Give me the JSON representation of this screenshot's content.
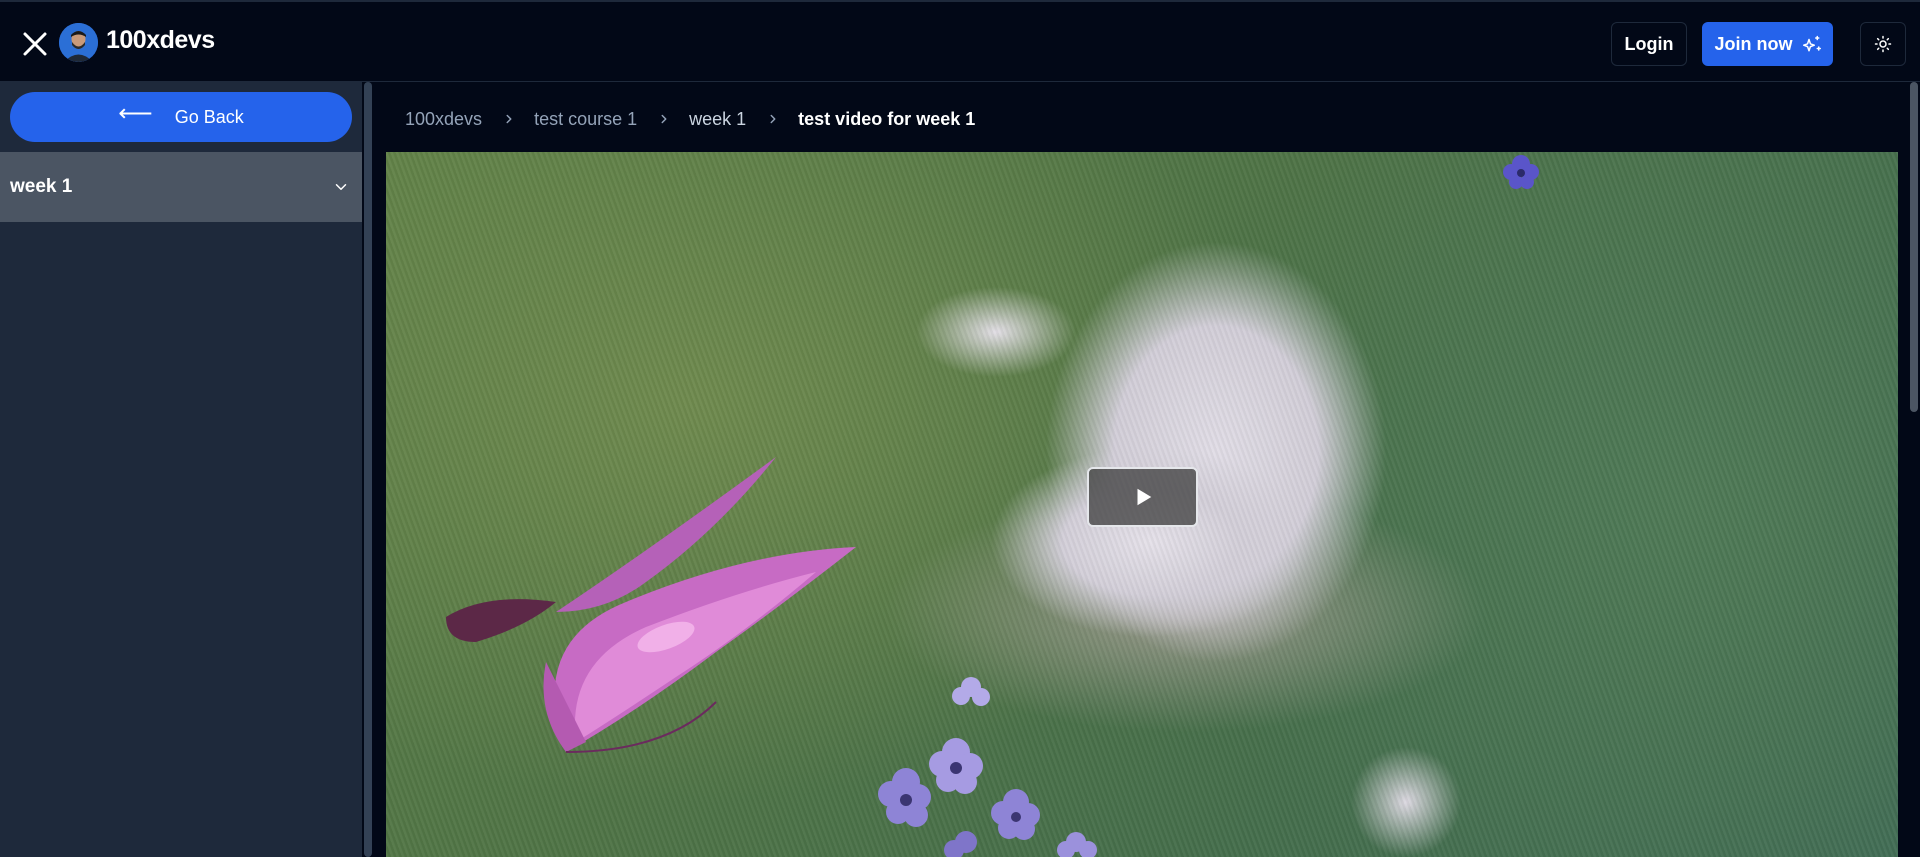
{
  "header": {
    "brand": "100xdevs",
    "login_label": "Login",
    "join_label": "Join now"
  },
  "sidebar": {
    "go_back_label": "Go Back",
    "sections": [
      {
        "label": "week 1",
        "expanded": false
      }
    ]
  },
  "breadcrumb": {
    "items": [
      "100xdevs",
      "test course 1",
      "week 1",
      "test video for week 1"
    ]
  },
  "video": {
    "state": "paused",
    "content": "animated rabbit lying in grass with a pink butterfly and purple flowers"
  },
  "colors": {
    "background": "#020817",
    "sidebar": "#1e293b",
    "accent": "#2563eb",
    "active_section": "#4b5563"
  },
  "icons": {
    "close": "close-icon",
    "arrow_left": "arrow-left-icon",
    "sparkles": "sparkles-icon",
    "sun": "sun-icon",
    "chevron_down": "chevron-down-icon",
    "chevron_right": "chevron-right-icon",
    "play": "play-icon"
  }
}
